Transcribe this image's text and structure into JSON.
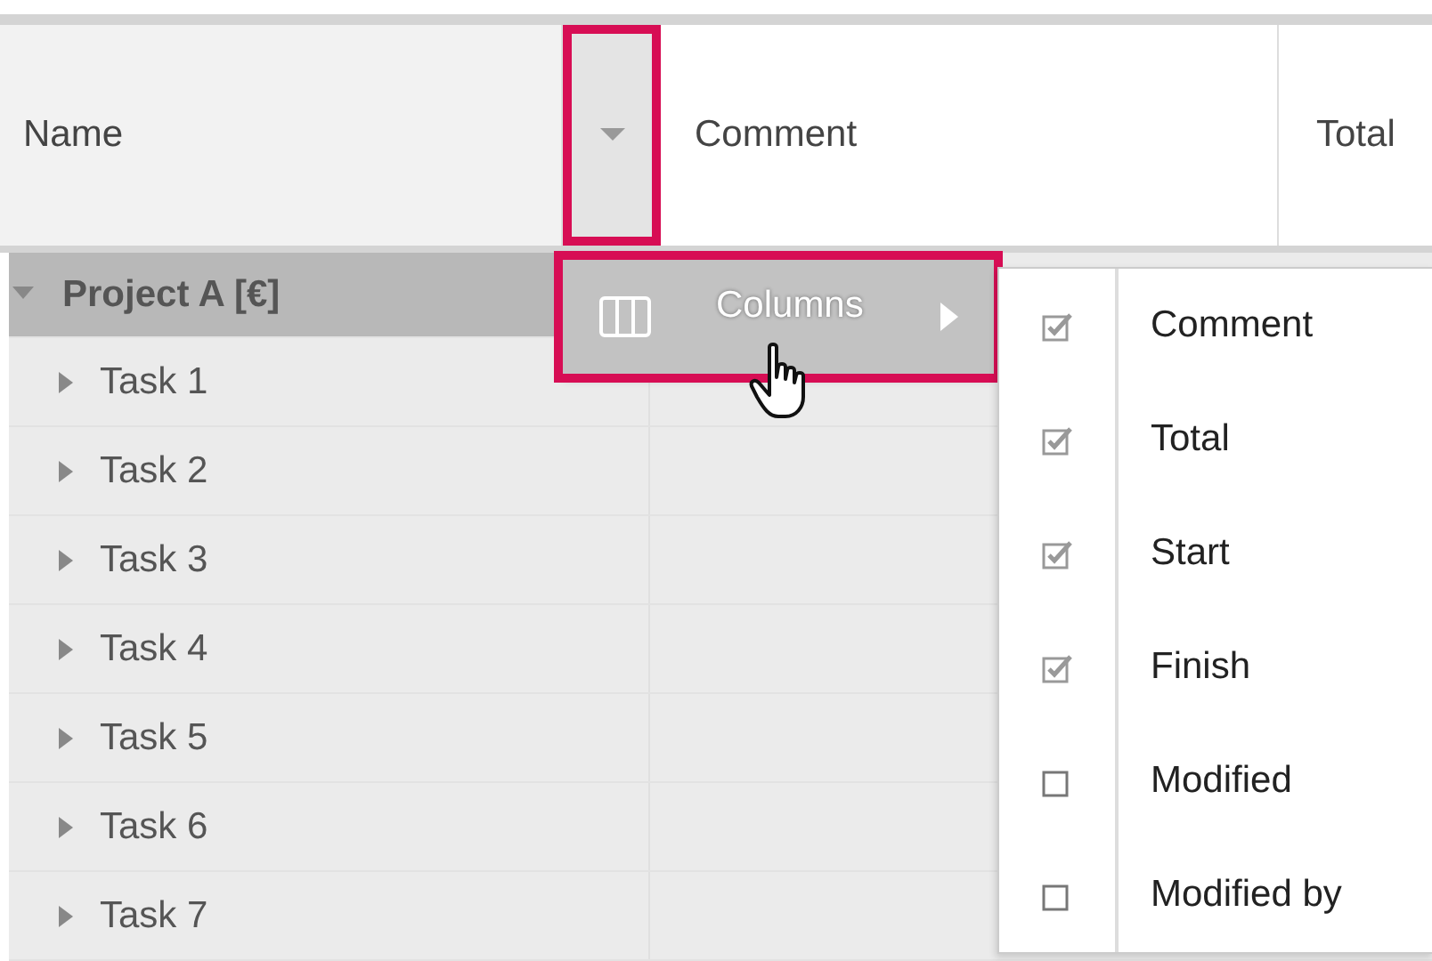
{
  "header": {
    "columns": [
      {
        "label": "Name",
        "kind": "name"
      },
      {
        "label": "Comment",
        "kind": "plain"
      },
      {
        "label": "Total",
        "kind": "plain"
      }
    ],
    "dropdown_highlighted": true
  },
  "tree": [
    {
      "label": "Project A [€]",
      "expanded": true,
      "selected": true,
      "children": [
        {
          "label": "Task 1",
          "expanded": false,
          "selected": false
        },
        {
          "label": "Task 2",
          "expanded": false,
          "selected": false
        },
        {
          "label": "Task 3",
          "expanded": false,
          "selected": false
        },
        {
          "label": "Task 4",
          "expanded": false,
          "selected": false
        },
        {
          "label": "Task 5",
          "expanded": false,
          "selected": false
        },
        {
          "label": "Task 6",
          "expanded": false,
          "selected": false
        },
        {
          "label": "Task 7",
          "expanded": false,
          "selected": false
        }
      ]
    }
  ],
  "column_menu": {
    "items": [
      {
        "label": "Columns",
        "selected": true,
        "highlighted": true
      }
    ]
  },
  "columns_submenu": [
    {
      "label": "Comment",
      "checked": true
    },
    {
      "label": "Total",
      "checked": true
    },
    {
      "label": "Start",
      "checked": true
    },
    {
      "label": "Finish",
      "checked": true
    },
    {
      "label": "Modified",
      "checked": false
    },
    {
      "label": "Modified by",
      "checked": false
    }
  ]
}
